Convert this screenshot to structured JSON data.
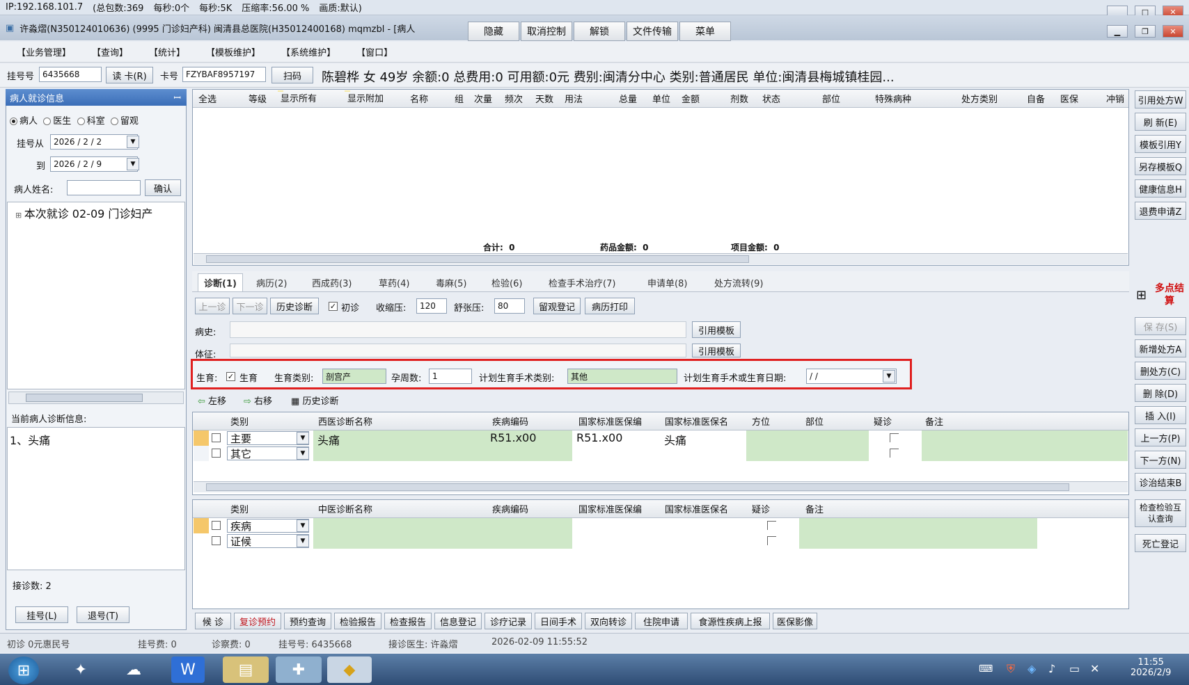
{
  "status_bar": {
    "ip": "IP:192.168.101.7",
    "total_packets": "(总包数:369",
    "per_sec_count": "每秒:0个",
    "per_sec_size": "每秒:5K",
    "compression": "压缩率:56.00 %",
    "quality": "画质:默认)"
  },
  "title_bar": {
    "title": "许淼熠(N350124010636) (9995 门诊妇产科) 闽清县总医院(H35012400168) mqmzbl - [病人",
    "remote_buttons": [
      "隐藏",
      "取消控制",
      "解锁",
      "文件传输",
      "菜单"
    ]
  },
  "menu": [
    "【业务管理】",
    "【查询】",
    "【统计】",
    "【模板维护】",
    "【系统维护】",
    "【窗口】"
  ],
  "patient_bar": {
    "reg_no_label": "挂号号",
    "reg_no_value": "6435668",
    "read_card": "读 卡(R)",
    "card_label": "卡号",
    "card_value": "FZYBAF8957197",
    "scan": "扫码",
    "patient_info": "陈碧桦  女  49岁  余额:0 总费用:0  可用额:0元  费别:闽清分中心  类别:普通居民  单位:闽清县梅城镇桂园..."
  },
  "left_panel": {
    "title": "病人就诊信息",
    "pin": "ꟷ",
    "radio_options": [
      "病人",
      "医生",
      "科室",
      "留观"
    ],
    "reg_from_label": "挂号从",
    "reg_from": "2026 / 2 / 2",
    "to_label": "到",
    "reg_to": "2026 / 2 / 9",
    "name_label": "病人姓名:",
    "confirm": "确认",
    "tree_item": "本次就诊  02-09  门诊妇产",
    "current_diag_label": "当前病人诊断信息:",
    "current_diag": "1、头痛",
    "visit_count": "接诊数: 2",
    "btn_register": "挂号(L)",
    "btn_unregister": "退号(T)"
  },
  "rx_table": {
    "headers": [
      "全选",
      "等级",
      "显示所有",
      "显示附加",
      "名称",
      "组",
      "次量",
      "频次",
      "天数",
      "用法",
      "总量",
      "单位",
      "金额",
      "剂数",
      "状态",
      "部位",
      "特殊病种",
      "处方类别",
      "自备",
      "医保",
      "冲销"
    ],
    "total_label": "合计:",
    "total": "0",
    "drug_label": "药品金额:",
    "drug_amount": "0",
    "item_label": "项目金额:",
    "item_amount": "0"
  },
  "tabs": [
    "诊断(1)",
    "病历(2)",
    "西成药(3)",
    "草药(4)",
    "毒麻(5)",
    "检验(6)",
    "检查手术治疗(7)",
    "申请单(8)",
    "处方流转(9)"
  ],
  "diag_toolbar": {
    "prev": "上一诊",
    "next": "下一诊",
    "history": "历史诊断",
    "first_visit": "初诊",
    "systolic_label": "收缩压:",
    "systolic": "120",
    "diastolic_label": "舒张压:",
    "diastolic": "80",
    "observe": "留观登记",
    "print": "病历打印"
  },
  "history_label": "病史:",
  "symptom_label": "体征:",
  "cite_template": "引用模板",
  "birth": {
    "label": "生育:",
    "checkbox_label": "生育",
    "type_label": "生育类别:",
    "type_value": "剖宫产",
    "weeks_label": "孕周数:",
    "weeks_value": "1",
    "plan_type_label": "计划生育手术类别:",
    "plan_type_value": "其他",
    "date_label": "计划生育手术或生育日期:",
    "date_value": "/   /"
  },
  "move": {
    "left": "左移",
    "right": "右移",
    "history": "历史诊断"
  },
  "west_table": {
    "headers": [
      "类别",
      "西医诊断名称",
      "疾病编码",
      "国家标准医保编",
      "国家标准医保名",
      "方位",
      "部位",
      "疑诊",
      "备注"
    ],
    "rows": [
      {
        "type": "主要",
        "name": "头痛",
        "code": "R51.x00",
        "nat_code": "R51.x00",
        "nat_name": "头痛"
      },
      {
        "type": "其它",
        "name": "",
        "code": "",
        "nat_code": "",
        "nat_name": ""
      }
    ]
  },
  "tcm_table": {
    "headers": [
      "类别",
      "中医诊断名称",
      "疾病编码",
      "国家标准医保编",
      "国家标准医保名",
      "疑诊",
      "备注"
    ],
    "rows": [
      {
        "type": "疾病"
      },
      {
        "type": "证候"
      }
    ]
  },
  "bottom_tabs": [
    "候 诊",
    "复诊预约",
    "预约查询",
    "检验报告",
    "检查报告",
    "信息登记",
    "诊疗记录",
    "日间手术",
    "双向转诊",
    "住院申请",
    "食源性疾病上报",
    "医保影像"
  ],
  "right_buttons": [
    "引用处方W",
    "刷 新(E)",
    "模板引用Y",
    "另存模板Q",
    "健康信息H",
    "退费申请Z",
    "保 存(S)",
    "新增处方A",
    "删处方(C)",
    "删 除(D)",
    "插 入(I)",
    "上一方(P)",
    "下一方(N)",
    "诊治结束B",
    "检查检验互认查询",
    "死亡登记"
  ],
  "multi_settle": "多点结算",
  "status_footer": {
    "first_visit": "初诊 0元惠民号",
    "reg_fee": "挂号费: 0",
    "diag_fee": "诊察费: 0",
    "reg_no": "挂号号: 6435668",
    "doctor": "接诊医生: 许淼熠",
    "datetime": "2026-02-09 11:55:52"
  },
  "taskbar": {
    "time": "11:55",
    "date": "2026/2/9"
  },
  "colors": {
    "highlight_box": "#e02020",
    "green_cell": "#cfe8c8",
    "yellow_cell": "#f5e9a8"
  }
}
